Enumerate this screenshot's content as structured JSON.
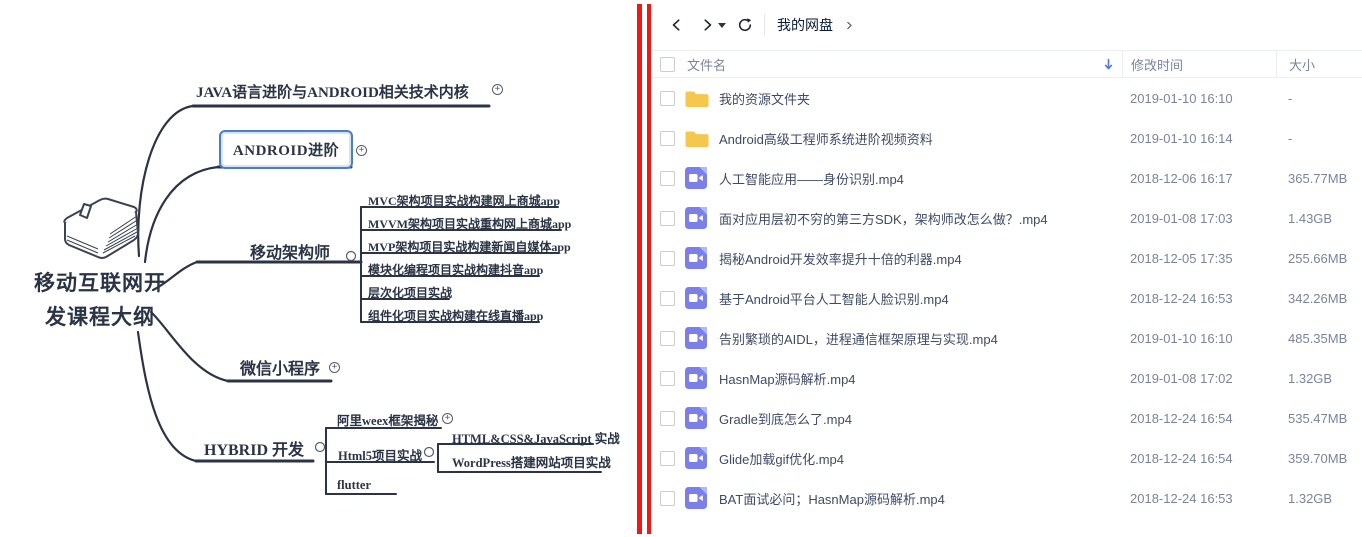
{
  "mindmap": {
    "root_line1": "移动互联网开",
    "root_line2": "发课程大纲",
    "java": "JAVA语言进阶与ANDROID相关技术内核",
    "android": "ANDROID进阶",
    "architect": "移动架构师",
    "architect_children": [
      "MVC架构项目实战构建网上商城app",
      "MVVM架构项目实战重构网上商城app",
      "MVP架构项目实战构建新闻自媒体app",
      "模块化编程项目实战构建抖音app",
      "层次化项目实战",
      "组件化项目实战构建在线直播app"
    ],
    "wechat": "微信小程序",
    "hybrid": "HYBRID 开发",
    "weex": "阿里weex框架揭秘",
    "html5": "Html5项目实战",
    "flutter": "flutter",
    "htmlcss": "HTML&CSS&JavaScript 实战",
    "wordpress": "WordPress搭建网站项目实战"
  },
  "filepanel": {
    "breadcrumb": "我的网盘",
    "breadcrumb_sep": ">",
    "columns": {
      "name": "文件名",
      "modified": "修改时间",
      "size": "大小"
    },
    "rows": [
      {
        "type": "folder",
        "name": "我的资源文件夹",
        "modified": "2019-01-10 16:10",
        "size": "-"
      },
      {
        "type": "folder",
        "name": "Android高级工程师系统进阶视频资料",
        "modified": "2019-01-10 16:14",
        "size": "-"
      },
      {
        "type": "video",
        "name": "人工智能应用——身份识别.mp4",
        "modified": "2018-12-06 16:17",
        "size": "365.77MB"
      },
      {
        "type": "video",
        "name": "面对应用层初不穷的第三方SDK，架构师改怎么做？.mp4",
        "modified": "2019-01-08 17:03",
        "size": "1.43GB"
      },
      {
        "type": "video",
        "name": "揭秘Android开发效率提升十倍的利器.mp4",
        "modified": "2018-12-05 17:35",
        "size": "255.66MB"
      },
      {
        "type": "video",
        "name": "基于Android平台人工智能人脸识别.mp4",
        "modified": "2018-12-24 16:53",
        "size": "342.26MB"
      },
      {
        "type": "video",
        "name": "告别繁琐的AIDL，进程通信框架原理与实现.mp4",
        "modified": "2019-01-10 16:10",
        "size": "485.35MB"
      },
      {
        "type": "video",
        "name": "HasnMap源码解析.mp4",
        "modified": "2019-01-08 17:02",
        "size": "1.32GB"
      },
      {
        "type": "video",
        "name": "Gradle到底怎么了.mp4",
        "modified": "2018-12-24 16:54",
        "size": "535.47MB"
      },
      {
        "type": "video",
        "name": "Glide加载gif优化.mp4",
        "modified": "2018-12-24 16:54",
        "size": "359.70MB"
      },
      {
        "type": "video",
        "name": "BAT面试必问；HasnMap源码解析.mp4",
        "modified": "2018-12-24 16:53",
        "size": "1.32GB"
      }
    ]
  },
  "colors": {
    "annotation_red": "#f21717",
    "folder_yellow": "#f6c74e",
    "video_purple": "#7b80e8",
    "video_fold": "#a9bdf4",
    "sort_arrow_blue": "#4a7dd6",
    "mindmap_line": "#2b3444",
    "android_box_border": "#4c7fc0"
  }
}
